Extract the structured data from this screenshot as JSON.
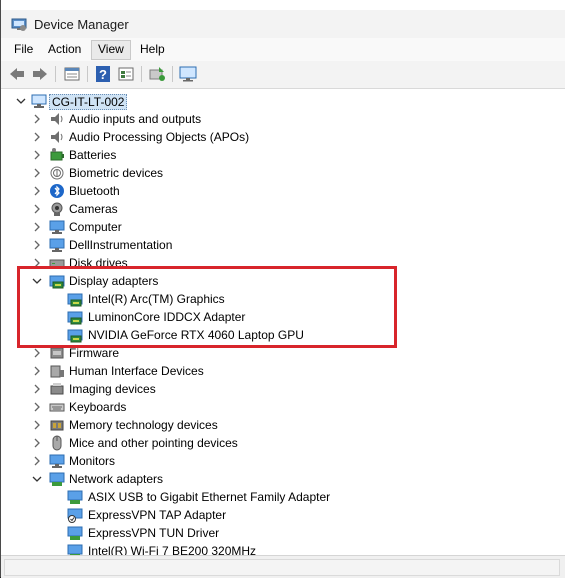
{
  "window": {
    "title": "Device Manager"
  },
  "menu": [
    "File",
    "Action",
    "View",
    "Help"
  ],
  "toolbar": [
    "back-arrow-icon",
    "forward-arrow-icon",
    "properties-icon",
    "help-icon",
    "view-icon",
    "update-driver-icon",
    "monitor-icon"
  ],
  "tree": {
    "root": "CG-IT-LT-002",
    "categories": [
      "Audio inputs and outputs",
      "Audio Processing Objects (APOs)",
      "Batteries",
      "Biometric devices",
      "Bluetooth",
      "Cameras",
      "Computer",
      "DellInstrumentation",
      "Disk drives",
      "Display adapters",
      "Firmware",
      "Human Interface Devices",
      "Imaging devices",
      "Keyboards",
      "Memory technology devices",
      "Mice and other pointing devices",
      "Monitors",
      "Network adapters"
    ],
    "display_children": [
      "Intel(R) Arc(TM) Graphics",
      "LuminonCore IDDCX Adapter",
      "NVIDIA GeForce RTX 4060 Laptop GPU"
    ],
    "network_children": [
      "ASIX USB to Gigabit Ethernet Family Adapter",
      "ExpressVPN TAP Adapter",
      "ExpressVPN TUN Driver",
      "Intel(R) Wi-Fi 7 BE200 320MHz"
    ]
  },
  "colors": {
    "highlight": "#d8252b",
    "selection": "#cfe3f5"
  }
}
